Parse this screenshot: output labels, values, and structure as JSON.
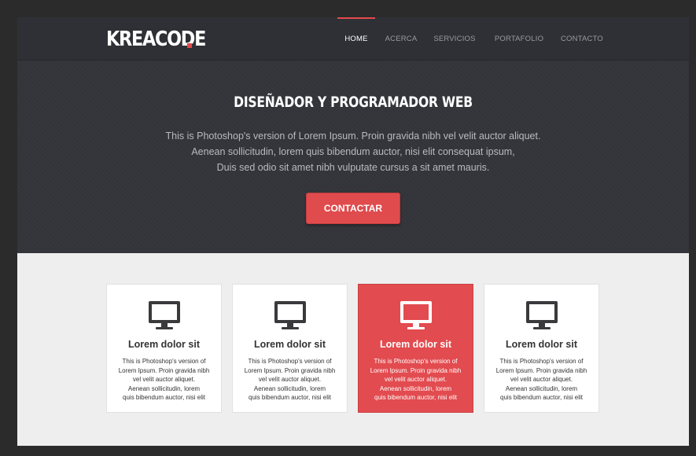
{
  "logo": {
    "text": "KREACODE"
  },
  "nav": [
    {
      "label": "HOME",
      "active": true
    },
    {
      "label": "ACERCA",
      "active": false
    },
    {
      "label": "SERVICIOS",
      "active": false
    },
    {
      "label": "PORTAFOLIO",
      "active": false
    },
    {
      "label": "CONTACTO",
      "active": false
    }
  ],
  "hero": {
    "title": "DISEÑADOR Y PROGRAMADOR WEB",
    "lines": [
      "This is Photoshop's version  of Lorem Ipsum. Proin gravida nibh vel velit auctor aliquet.",
      "Aenean sollicitudin, lorem quis bibendum auctor, nisi elit consequat ipsum,",
      "Duis sed odio sit amet nibh vulputate cursus a sit amet mauris."
    ],
    "cta_label": "CONTACTAR"
  },
  "features": [
    {
      "icon": "monitor-icon",
      "title": "Lorem dolor sit",
      "highlighted": false,
      "lines": [
        "This is Photoshop's version  of",
        "Lorem Ipsum. Proin gravida nibh",
        "vel velit auctor aliquet.",
        "Aenean sollicitudin, lorem",
        "quis  bibendum auctor, nisi elit"
      ]
    },
    {
      "icon": "monitor-icon",
      "title": "Lorem dolor sit",
      "highlighted": false,
      "lines": [
        "This is Photoshop's version  of",
        "Lorem Ipsum. Proin gravida nibh",
        "vel velit auctor aliquet.",
        "Aenean sollicitudin, lorem",
        "quis  bibendum auctor, nisi elit"
      ]
    },
    {
      "icon": "monitor-icon",
      "title": "Lorem dolor sit",
      "highlighted": true,
      "lines": [
        "This is Photoshop's version  of",
        "Lorem Ipsum. Proin gravida nibh",
        "vel velit auctor aliquet.",
        "Aenean sollicitudin, lorem",
        "quis  bibendum auctor, nisi elit"
      ]
    },
    {
      "icon": "monitor-icon",
      "title": "Lorem dolor sit",
      "highlighted": false,
      "lines": [
        "This is Photoshop's version  of",
        "Lorem Ipsum. Proin gravida nibh",
        "vel velit auctor aliquet.",
        "Aenean sollicitudin, lorem",
        "quis  bibendum auctor, nisi elit"
      ]
    }
  ],
  "colors": {
    "accent": "#e24b4b",
    "header_bg": "#2f3036",
    "hero_bg": "#34353b",
    "section_bg": "#eeeeee"
  }
}
